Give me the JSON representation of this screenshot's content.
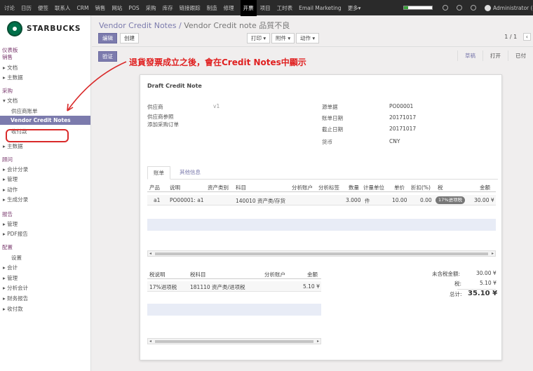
{
  "topbar": {
    "menu": [
      "讨论",
      "日历",
      "便签",
      "联系人",
      "CRM",
      "销售",
      "网站",
      "POS",
      "采购",
      "库存",
      "链接跟踪",
      "制造",
      "修理",
      "开票",
      "项目",
      "工时表",
      "Email Marketing",
      "更多▾"
    ],
    "active_index": 13,
    "user": "Administrator (odo"
  },
  "brand": {
    "name": "STARBUCKS",
    "color": "#00704a"
  },
  "sidebar": {
    "items": [
      {
        "label": "仪表板",
        "level": "sec"
      },
      {
        "label": "销售",
        "level": "sec"
      },
      {
        "label": "▸ 文档",
        "level": "sub"
      },
      {
        "label": "▸ 主数据",
        "level": "sub"
      },
      {
        "label": "采购",
        "level": "sec"
      },
      {
        "label": "▾ 文档",
        "level": "sub"
      },
      {
        "label": "供应商账单",
        "level": "sub2"
      },
      {
        "label": "Vendor Credit Notes",
        "level": "sel"
      },
      {
        "label": "收付款",
        "level": "sub2"
      },
      {
        "label": "▸ 主数据",
        "level": "sub"
      },
      {
        "label": "顾问",
        "level": "sec"
      },
      {
        "label": "▸ 会计分录",
        "level": "sub"
      },
      {
        "label": "▸ 管理",
        "level": "sub"
      },
      {
        "label": "▸ 动作",
        "level": "sub"
      },
      {
        "label": "▸ 生成分录",
        "level": "sub"
      },
      {
        "label": "报告",
        "level": "sec"
      },
      {
        "label": "▸ 管理",
        "level": "sub"
      },
      {
        "label": "▸ PDF报告",
        "level": "sub"
      },
      {
        "label": "配置",
        "level": "sec"
      },
      {
        "label": "设置",
        "level": "sub2"
      },
      {
        "label": "▸ 会计",
        "level": "sub"
      },
      {
        "label": "▸ 管理",
        "level": "sub"
      },
      {
        "label": "▸ 分析会计",
        "level": "sub"
      },
      {
        "label": "▸ 财务报告",
        "level": "sub"
      },
      {
        "label": "▸ 收付款",
        "level": "sub"
      }
    ]
  },
  "breadcrumb": {
    "parent": "Vendor Credit Notes",
    "sep": "/",
    "current": "Vendor Credit note 品質不良"
  },
  "toolbar": {
    "edit": "编辑",
    "create": "创建",
    "print": "打印 ▾",
    "attach": "附件 ▾",
    "action": "动作 ▾"
  },
  "pager": {
    "text": "1 / 1",
    "prev": "‹"
  },
  "validate": "验证",
  "statusbar": [
    "草稿",
    "打开",
    "已付"
  ],
  "annotation": "退貨發票成立之後，會在Credit Notes中顯示",
  "sheet": {
    "title": "Draft Credit Note",
    "left_fields": [
      {
        "label": "供应商",
        "value": "v1"
      },
      {
        "label": "供应商参照",
        "value": ""
      },
      {
        "label": "添加采购订单",
        "value": ""
      }
    ],
    "right_fields": [
      {
        "label": "源单据",
        "value": "PO00001"
      },
      {
        "label": "账单日期",
        "value": "20171017"
      },
      {
        "label": "截止日期",
        "value": "20171017"
      },
      {
        "label": "货币",
        "value": "CNY"
      }
    ],
    "tabs": [
      "账单",
      "其他信息"
    ],
    "lines_header": [
      "产品",
      "说明",
      "资产类别",
      "科目",
      "分析账户",
      "分析标签",
      "数量",
      "计量单位",
      "单价",
      "折扣(%)",
      "税",
      "金额"
    ],
    "lines": [
      {
        "product": "a1",
        "desc": "PO00001: a1",
        "asset": "",
        "account": "140010 资产类/存货",
        "analytic": "",
        "tags": "",
        "qty": "3.000",
        "uom": "件",
        "price": "10.00",
        "disc": "0.00",
        "tax": "17%进项税",
        "amount": "30.00 ¥"
      }
    ],
    "tax_header": [
      "税说明",
      "税科目",
      "分析账户",
      "金额"
    ],
    "tax_lines": [
      {
        "desc": "17%进项税",
        "account": "181110 资产类/进项税",
        "analytic": "",
        "amount": "5.10 ¥"
      }
    ],
    "totals": {
      "untaxed_label": "未含税金额:",
      "untaxed": "30.00 ¥",
      "tax_label": "税:",
      "tax": "5.10 ¥",
      "total_label": "总计:",
      "total": "35.10 ¥"
    }
  },
  "colors": {
    "accent": "#7c7bad",
    "annotation": "#e02020",
    "topbar": "#2a2a2a"
  }
}
